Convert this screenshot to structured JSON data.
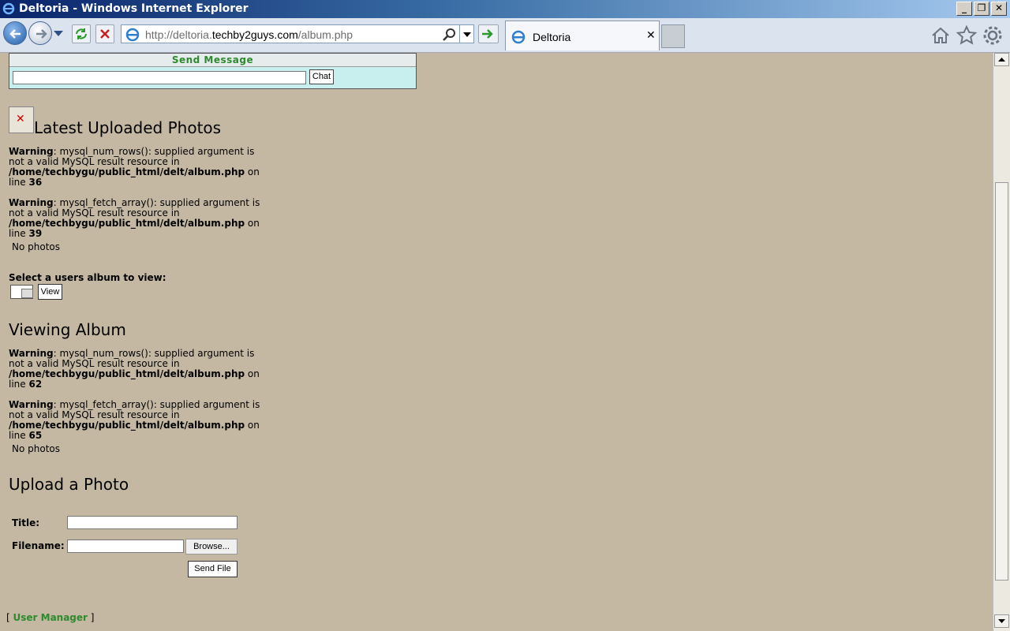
{
  "window": {
    "title": "Deltoria - Windows Internet Explorer",
    "controls": [
      "_",
      "❐",
      "✕"
    ]
  },
  "toolbar": {
    "url_prefix": "http://deltoria.",
    "url_domain": "techby2guys.com",
    "url_path": "/album.php",
    "tab_label": "Deltoria"
  },
  "chat": {
    "header": "Send Message",
    "button": "Chat",
    "input_value": ""
  },
  "latest": {
    "title": "Latest Uploaded Photos",
    "warnings": [
      {
        "label": "Warning",
        "msg": ": mysql_num_rows(): supplied argument is not a valid MySQL result resource in ",
        "path": "/home/techbygu/public_html/delt/album.php",
        "online": " on line ",
        "line": "36"
      },
      {
        "label": "Warning",
        "msg": ": mysql_fetch_array(): supplied argument is not a valid MySQL result resource in ",
        "path": "/home/techbygu/public_html/delt/album.php",
        "online": " on line ",
        "line": "39"
      }
    ],
    "empty": "No photos"
  },
  "select_album": {
    "label": "Select a users album to view:",
    "button": "View"
  },
  "viewing": {
    "title": "Viewing Album",
    "warnings": [
      {
        "label": "Warning",
        "msg": ": mysql_num_rows(): supplied argument is not a valid MySQL result resource in ",
        "path": "/home/techbygu/public_html/delt/album.php",
        "online": " on line ",
        "line": "62"
      },
      {
        "label": "Warning",
        "msg": ": mysql_fetch_array(): supplied argument is not a valid MySQL result resource in ",
        "path": "/home/techbygu/public_html/delt/album.php",
        "online": " on line ",
        "line": "65"
      }
    ],
    "empty": "No photos"
  },
  "upload": {
    "title": "Upload a Photo",
    "title_label": "Title:",
    "filename_label": "Filename:",
    "browse": "Browse...",
    "send": "Send File"
  },
  "footer": {
    "open": "[ ",
    "link": "User Manager",
    "close": " ]"
  },
  "colors": {
    "page_bg": "#c4b8a2",
    "chat_bg": "#c8eeee",
    "link": "#2d8a2d"
  }
}
